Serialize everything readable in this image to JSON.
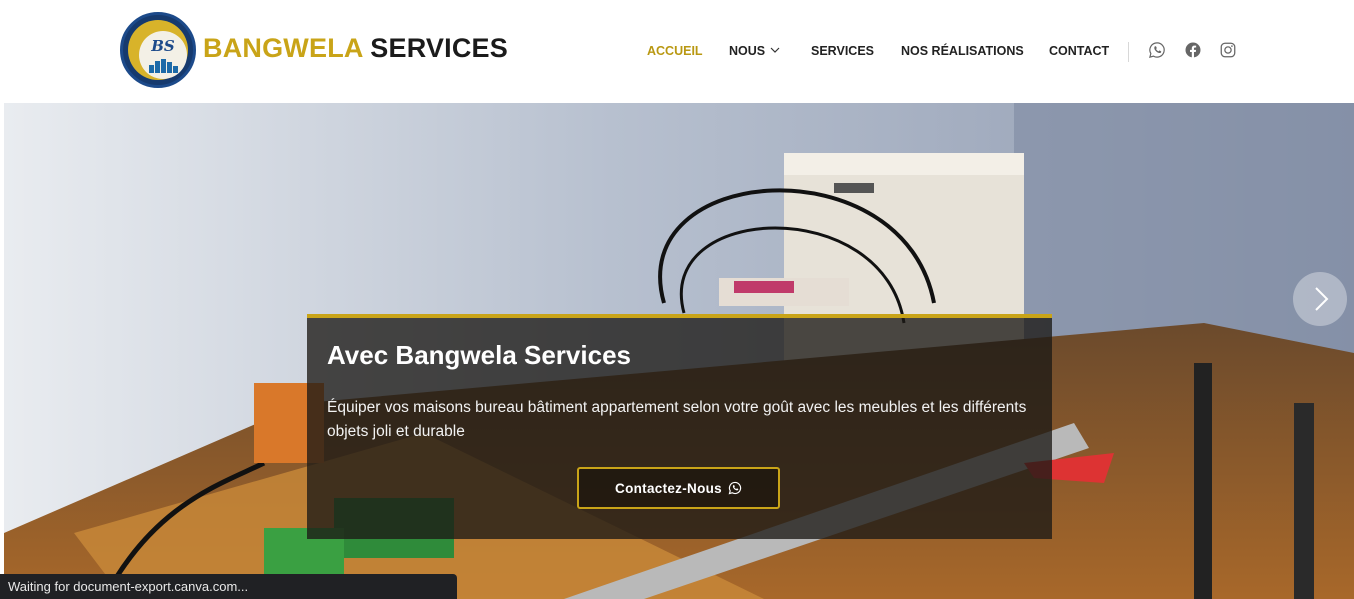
{
  "header": {
    "logo_text": "BANGWELA SERVICES",
    "logo_monogram": "BS",
    "brand_part1": "BANGWELA",
    "brand_part2": "SERVICES"
  },
  "nav": {
    "items": [
      {
        "label": "ACCUEIL",
        "active": true
      },
      {
        "label": "NOUS",
        "has_dropdown": true
      },
      {
        "label": "SERVICES"
      },
      {
        "label": "NOS RÉALISATIONS"
      },
      {
        "label": "CONTACT"
      }
    ],
    "social": [
      "whatsapp-icon",
      "facebook-icon",
      "instagram-icon"
    ]
  },
  "hero": {
    "title": "Avec Bangwela Services",
    "text": "Équiper vos maisons bureau bâtiment appartement selon votre goût avec les meubles et les différents objets joli et durable",
    "button_label": "Contactez-Nous",
    "button_icon": "whatsapp-icon"
  },
  "status_bar": {
    "text": "Waiting for document-export.canva.com..."
  },
  "colors": {
    "accent": "#c9a418",
    "nav_active": "#b99812",
    "text_dark": "#1b1b1b",
    "caption_bg": "#1c1a16"
  }
}
